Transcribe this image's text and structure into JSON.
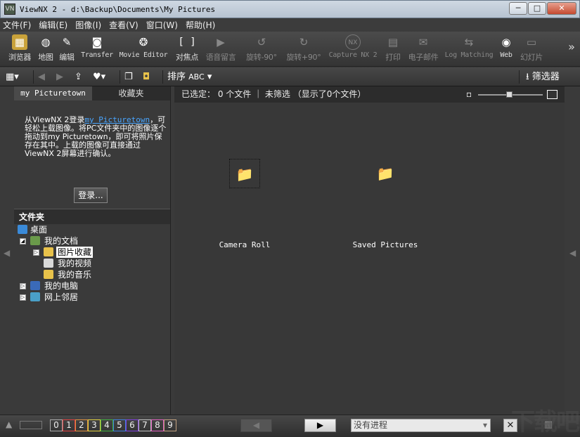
{
  "window": {
    "title": "ViewNX 2 - d:\\Backup\\Documents\\My Pictures",
    "min": "─",
    "max": "□",
    "close": "✕"
  },
  "menu": [
    "文件(F)",
    "编辑(E)",
    "图像(I)",
    "查看(V)",
    "窗口(W)",
    "帮助(H)"
  ],
  "toolbar": [
    {
      "label": "浏览器",
      "icon": "browser-icon",
      "glyph": "▦",
      "enabled": true
    },
    {
      "label": "地图",
      "icon": "globe-icon",
      "glyph": "◍",
      "enabled": true
    },
    {
      "label": "编辑",
      "icon": "edit-icon",
      "glyph": "✎",
      "enabled": true
    },
    {
      "label": "Transfer",
      "icon": "camera-icon",
      "glyph": "◙",
      "enabled": true
    },
    {
      "label": "Movie Editor",
      "icon": "film-reel-icon",
      "glyph": "❂",
      "enabled": true
    },
    {
      "label": "对焦点",
      "icon": "focus-point-icon",
      "glyph": "[ ]",
      "enabled": true
    },
    {
      "label": "语音留言",
      "icon": "play-icon",
      "glyph": "▶",
      "enabled": false
    },
    {
      "label": "旋转-90°",
      "icon": "rotate-left-icon",
      "glyph": "↺",
      "enabled": false
    },
    {
      "label": "旋转+90°",
      "icon": "rotate-right-icon",
      "glyph": "↻",
      "enabled": false
    },
    {
      "label": "Capture NX 2",
      "icon": "capture-nx-icon",
      "glyph": "NX",
      "enabled": false
    },
    {
      "label": "打印",
      "icon": "print-icon",
      "glyph": "▤",
      "enabled": false
    },
    {
      "label": "电子邮件",
      "icon": "email-icon",
      "glyph": "✉",
      "enabled": false
    },
    {
      "label": "Log Matching",
      "icon": "log-matching-icon",
      "glyph": "⇆",
      "enabled": false
    },
    {
      "label": "Web",
      "icon": "web-icon",
      "glyph": "◉",
      "enabled": true
    },
    {
      "label": "幻灯片",
      "icon": "slideshow-icon",
      "glyph": "▭",
      "enabled": false
    }
  ],
  "toolbar_more": "»",
  "toolbar2": {
    "sort_label": "排序",
    "sort_value": "ABC",
    "filter_label": "筛选器"
  },
  "left_panel": {
    "tabs": [
      "my Picturetown",
      "收藏夹"
    ],
    "desc_1": "从ViewNX 2登录",
    "desc_link": "my Picturetown",
    "desc_2": "，可轻松上载图像。将PC文件夹中的图像逐个拖动到my Picturetown，即可将照片保存在其中。上载的图像可直接通过ViewNX 2屏幕进行确认。",
    "login_button": "登录...",
    "folder_header": "文件夹",
    "tree": [
      {
        "label": "桌面",
        "level": 0,
        "icon": "desktop-icon",
        "expander": ""
      },
      {
        "label": "我的文档",
        "level": 1,
        "icon": "documents-folder-icon",
        "expander": "◢"
      },
      {
        "label": "图片收藏",
        "level": 2,
        "icon": "pictures-folder-icon",
        "expander": "▷",
        "selected": true
      },
      {
        "label": "我的视频",
        "level": 2,
        "icon": "videos-folder-icon",
        "expander": ""
      },
      {
        "label": "我的音乐",
        "level": 2,
        "icon": "music-folder-icon",
        "expander": ""
      },
      {
        "label": "我的电脑",
        "level": 1,
        "icon": "computer-icon",
        "expander": "▷"
      },
      {
        "label": "网上邻居",
        "level": 1,
        "icon": "network-icon",
        "expander": "▷"
      }
    ]
  },
  "content": {
    "status": "已选定： 0 个文件 ｜ 未筛选 （显示了0个文件）",
    "folders": [
      "Camera Roll",
      "Saved Pictures"
    ]
  },
  "bottom": {
    "labels": [
      "0",
      "1",
      "2",
      "3",
      "4",
      "5",
      "6",
      "7",
      "8",
      "9"
    ],
    "label_colors": [
      "#aaaaaa",
      "#e04040",
      "#e09040",
      "#e0d040",
      "#40b040",
      "#4080e0",
      "#8040e0",
      "#c0c0c0",
      "#e060c0",
      "#c0a080"
    ],
    "progress": "没有进程"
  },
  "watermark": "下载吧"
}
